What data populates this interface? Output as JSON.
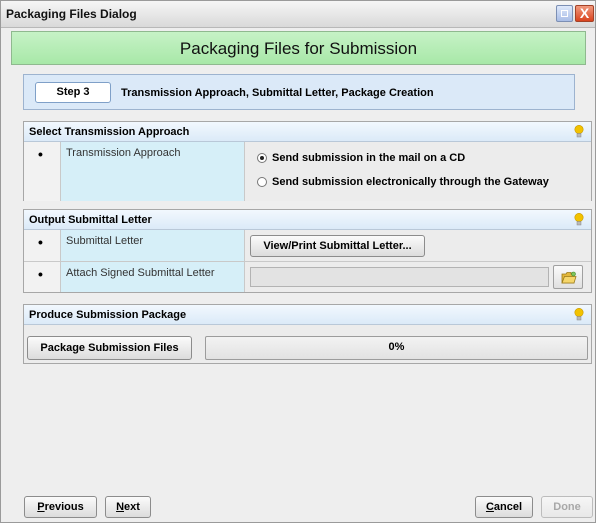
{
  "window": {
    "title": "Packaging Files Dialog",
    "close_glyph": "X"
  },
  "header": {
    "title": "Packaging Files for Submission"
  },
  "step": {
    "label": "Step 3",
    "description": "Transmission Approach, Submittal Letter, Package Creation"
  },
  "bullet": "•",
  "transmission": {
    "section_title": "Select Transmission Approach",
    "row_label": "Transmission Approach",
    "options": [
      {
        "label": "Send submission in the mail on a CD",
        "selected": true
      },
      {
        "label": "Send submission electronically through the Gateway",
        "selected": false
      }
    ]
  },
  "submittal": {
    "section_title": "Output Submittal Letter",
    "rows": [
      {
        "label": "Submittal Letter",
        "button": "View/Print Submittal Letter..."
      },
      {
        "label": "Attach Signed Submittal Letter",
        "value": ""
      }
    ]
  },
  "package": {
    "section_title": "Produce Submission Package",
    "button": "Package Submission Files",
    "progress": {
      "value": 0,
      "text": "0%"
    }
  },
  "footer": {
    "previous_first": "P",
    "previous_rest": "revious",
    "next_first": "N",
    "next_rest": "ext",
    "cancel_first": "C",
    "cancel_rest": "ancel",
    "done": "Done"
  },
  "icons": {
    "hint": "lightbulb-icon",
    "browse": "folder-icon",
    "minimize": "minimize-icon",
    "close": "close-icon"
  },
  "colors": {
    "header_green": "#b6edb6",
    "label_cell": "#d6eff8",
    "bulb": "#f2c200"
  }
}
